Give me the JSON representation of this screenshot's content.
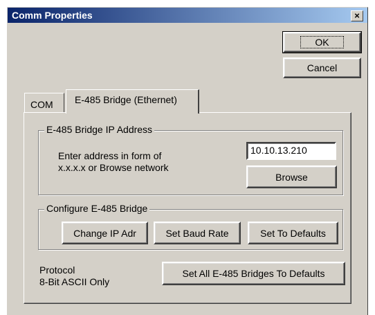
{
  "window": {
    "title": "Comm Properties",
    "close_label": "×"
  },
  "buttons": {
    "ok": "OK",
    "cancel": "Cancel"
  },
  "tabs": [
    {
      "label": "COM"
    },
    {
      "label": "E-485 Bridge (Ethernet)"
    }
  ],
  "ip_group": {
    "label": "E-485 Bridge IP Address",
    "instruction_line1": "Enter address in form of",
    "instruction_line2": "x.x.x.x or Browse network",
    "ip_value": "10.10.13.210",
    "browse_label": "Browse"
  },
  "config_group": {
    "label": "Configure E-485 Bridge",
    "change_ip_label": "Change IP Adr",
    "set_baud_label": "Set Baud Rate",
    "set_defaults_label": "Set To Defaults"
  },
  "protocol": {
    "line1": "Protocol",
    "line2": "8-Bit ASCII Only"
  },
  "set_all_label": "Set All E-485 Bridges To Defaults"
}
